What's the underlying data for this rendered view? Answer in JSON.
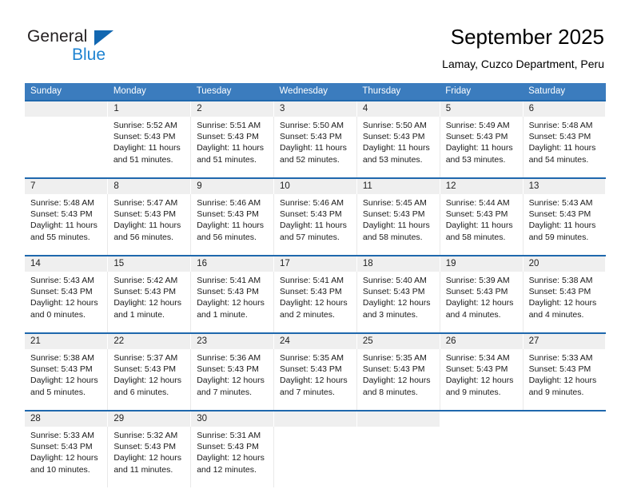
{
  "brand": {
    "name_part1": "General",
    "name_part2": "Blue",
    "triangle_icon": "triangle-icon",
    "color_dark": "#231f20",
    "color_blue": "#1f83d1"
  },
  "header": {
    "title": "September 2025",
    "subtitle": "Lamay, Cuzco Department, Peru"
  },
  "theme": {
    "header_blue": "#3b7cbe",
    "separator_blue": "#1f68ad",
    "daynum_bg": "#efefef",
    "cell_bg": "#ffffff"
  },
  "weekday_headers": [
    "Sunday",
    "Monday",
    "Tuesday",
    "Wednesday",
    "Thursday",
    "Friday",
    "Saturday"
  ],
  "weeks": [
    {
      "days": [
        {
          "date": "",
          "lines": [
            "",
            "",
            "",
            ""
          ],
          "empty": true
        },
        {
          "date": "1",
          "lines": [
            "Sunrise: 5:52 AM",
            "Sunset: 5:43 PM",
            "Daylight: 11 hours",
            "and 51 minutes."
          ],
          "empty": false
        },
        {
          "date": "2",
          "lines": [
            "Sunrise: 5:51 AM",
            "Sunset: 5:43 PM",
            "Daylight: 11 hours",
            "and 51 minutes."
          ],
          "empty": false
        },
        {
          "date": "3",
          "lines": [
            "Sunrise: 5:50 AM",
            "Sunset: 5:43 PM",
            "Daylight: 11 hours",
            "and 52 minutes."
          ],
          "empty": false
        },
        {
          "date": "4",
          "lines": [
            "Sunrise: 5:50 AM",
            "Sunset: 5:43 PM",
            "Daylight: 11 hours",
            "and 53 minutes."
          ],
          "empty": false
        },
        {
          "date": "5",
          "lines": [
            "Sunrise: 5:49 AM",
            "Sunset: 5:43 PM",
            "Daylight: 11 hours",
            "and 53 minutes."
          ],
          "empty": false
        },
        {
          "date": "6",
          "lines": [
            "Sunrise: 5:48 AM",
            "Sunset: 5:43 PM",
            "Daylight: 11 hours",
            "and 54 minutes."
          ],
          "empty": false
        }
      ]
    },
    {
      "days": [
        {
          "date": "7",
          "lines": [
            "Sunrise: 5:48 AM",
            "Sunset: 5:43 PM",
            "Daylight: 11 hours",
            "and 55 minutes."
          ],
          "empty": false
        },
        {
          "date": "8",
          "lines": [
            "Sunrise: 5:47 AM",
            "Sunset: 5:43 PM",
            "Daylight: 11 hours",
            "and 56 minutes."
          ],
          "empty": false
        },
        {
          "date": "9",
          "lines": [
            "Sunrise: 5:46 AM",
            "Sunset: 5:43 PM",
            "Daylight: 11 hours",
            "and 56 minutes."
          ],
          "empty": false
        },
        {
          "date": "10",
          "lines": [
            "Sunrise: 5:46 AM",
            "Sunset: 5:43 PM",
            "Daylight: 11 hours",
            "and 57 minutes."
          ],
          "empty": false
        },
        {
          "date": "11",
          "lines": [
            "Sunrise: 5:45 AM",
            "Sunset: 5:43 PM",
            "Daylight: 11 hours",
            "and 58 minutes."
          ],
          "empty": false
        },
        {
          "date": "12",
          "lines": [
            "Sunrise: 5:44 AM",
            "Sunset: 5:43 PM",
            "Daylight: 11 hours",
            "and 58 minutes."
          ],
          "empty": false
        },
        {
          "date": "13",
          "lines": [
            "Sunrise: 5:43 AM",
            "Sunset: 5:43 PM",
            "Daylight: 11 hours",
            "and 59 minutes."
          ],
          "empty": false
        }
      ]
    },
    {
      "days": [
        {
          "date": "14",
          "lines": [
            "Sunrise: 5:43 AM",
            "Sunset: 5:43 PM",
            "Daylight: 12 hours",
            "and 0 minutes."
          ],
          "empty": false
        },
        {
          "date": "15",
          "lines": [
            "Sunrise: 5:42 AM",
            "Sunset: 5:43 PM",
            "Daylight: 12 hours",
            "and 1 minute."
          ],
          "empty": false
        },
        {
          "date": "16",
          "lines": [
            "Sunrise: 5:41 AM",
            "Sunset: 5:43 PM",
            "Daylight: 12 hours",
            "and 1 minute."
          ],
          "empty": false
        },
        {
          "date": "17",
          "lines": [
            "Sunrise: 5:41 AM",
            "Sunset: 5:43 PM",
            "Daylight: 12 hours",
            "and 2 minutes."
          ],
          "empty": false
        },
        {
          "date": "18",
          "lines": [
            "Sunrise: 5:40 AM",
            "Sunset: 5:43 PM",
            "Daylight: 12 hours",
            "and 3 minutes."
          ],
          "empty": false
        },
        {
          "date": "19",
          "lines": [
            "Sunrise: 5:39 AM",
            "Sunset: 5:43 PM",
            "Daylight: 12 hours",
            "and 4 minutes."
          ],
          "empty": false
        },
        {
          "date": "20",
          "lines": [
            "Sunrise: 5:38 AM",
            "Sunset: 5:43 PM",
            "Daylight: 12 hours",
            "and 4 minutes."
          ],
          "empty": false
        }
      ]
    },
    {
      "days": [
        {
          "date": "21",
          "lines": [
            "Sunrise: 5:38 AM",
            "Sunset: 5:43 PM",
            "Daylight: 12 hours",
            "and 5 minutes."
          ],
          "empty": false
        },
        {
          "date": "22",
          "lines": [
            "Sunrise: 5:37 AM",
            "Sunset: 5:43 PM",
            "Daylight: 12 hours",
            "and 6 minutes."
          ],
          "empty": false
        },
        {
          "date": "23",
          "lines": [
            "Sunrise: 5:36 AM",
            "Sunset: 5:43 PM",
            "Daylight: 12 hours",
            "and 7 minutes."
          ],
          "empty": false
        },
        {
          "date": "24",
          "lines": [
            "Sunrise: 5:35 AM",
            "Sunset: 5:43 PM",
            "Daylight: 12 hours",
            "and 7 minutes."
          ],
          "empty": false
        },
        {
          "date": "25",
          "lines": [
            "Sunrise: 5:35 AM",
            "Sunset: 5:43 PM",
            "Daylight: 12 hours",
            "and 8 minutes."
          ],
          "empty": false
        },
        {
          "date": "26",
          "lines": [
            "Sunrise: 5:34 AM",
            "Sunset: 5:43 PM",
            "Daylight: 12 hours",
            "and 9 minutes."
          ],
          "empty": false
        },
        {
          "date": "27",
          "lines": [
            "Sunrise: 5:33 AM",
            "Sunset: 5:43 PM",
            "Daylight: 12 hours",
            "and 9 minutes."
          ],
          "empty": false
        }
      ]
    },
    {
      "days": [
        {
          "date": "28",
          "lines": [
            "Sunrise: 5:33 AM",
            "Sunset: 5:43 PM",
            "Daylight: 12 hours",
            "and 10 minutes."
          ],
          "empty": false
        },
        {
          "date": "29",
          "lines": [
            "Sunrise: 5:32 AM",
            "Sunset: 5:43 PM",
            "Daylight: 12 hours",
            "and 11 minutes."
          ],
          "empty": false
        },
        {
          "date": "30",
          "lines": [
            "Sunrise: 5:31 AM",
            "Sunset: 5:43 PM",
            "Daylight: 12 hours",
            "and 12 minutes."
          ],
          "empty": false
        },
        {
          "date": "",
          "lines": [
            "",
            "",
            "",
            ""
          ],
          "empty": true
        },
        {
          "date": "",
          "lines": [
            "",
            "",
            "",
            ""
          ],
          "empty": true
        },
        {
          "date": "",
          "lines": [
            "",
            "",
            "",
            ""
          ],
          "empty": true,
          "hidden": true
        },
        {
          "date": "",
          "lines": [
            "",
            "",
            "",
            ""
          ],
          "empty": true,
          "hidden": true
        }
      ]
    }
  ]
}
